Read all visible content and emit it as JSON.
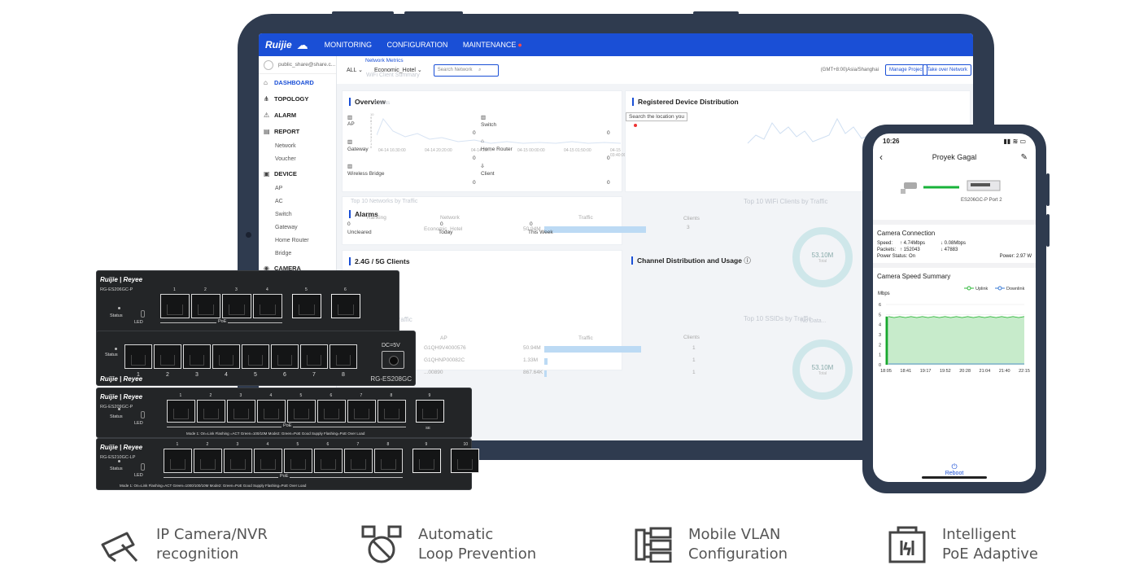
{
  "tablet": {
    "topbar": {
      "brand": "Ruijie",
      "nav": [
        "MONITORING",
        "CONFIGURATION",
        "MAINTENANCE"
      ]
    },
    "sidebar": {
      "user": "public_share@share.c...",
      "items": [
        {
          "label": "DASHBOARD",
          "icon": "home-icon",
          "active": true
        },
        {
          "label": "TOPOLOGY",
          "icon": "topology-icon"
        },
        {
          "label": "ALARM",
          "icon": "bell-icon"
        },
        {
          "label": "REPORT",
          "icon": "report-icon",
          "subs": [
            "Network",
            "Voucher"
          ]
        },
        {
          "label": "DEVICE",
          "icon": "device-icon",
          "subs": [
            "AP",
            "AC",
            "Switch",
            "Gateway",
            "Home Router",
            "Bridge"
          ]
        },
        {
          "label": "CAMERA",
          "icon": "camera-icon"
        }
      ]
    },
    "filterbar": {
      "crumb": "Network Metrics",
      "scope": "ALL",
      "project": "Economic_Hotel",
      "ghost": "WiFi Client Summary",
      "search_placeholder": "Search Network",
      "timezone": "(GMT+8:00)Asia/Shanghai",
      "manage_btn": "Manage Project",
      "takeover_btn": "Take over Network"
    },
    "overview": {
      "title": "Overview",
      "ghost": "Clients",
      "cells": [
        {
          "label": "AP",
          "value": "0"
        },
        {
          "label": "Switch",
          "value": "0"
        },
        {
          "label": "Gateway",
          "value": "0"
        },
        {
          "label": "Home Router",
          "value": "0"
        },
        {
          "label": "Wireless Bridge",
          "value": "0"
        },
        {
          "label": "Client",
          "value": "0"
        }
      ],
      "axis_ticks": [
        "10",
        "9",
        "8",
        "7",
        "6",
        "5",
        "4",
        "3",
        "2",
        "1",
        "0"
      ],
      "time_ticks": [
        "04-14 16:30:00",
        "04-14 20:20:00",
        "04-14 23:...",
        "04-15 00:00:00",
        "04-15 01:50:00",
        "04-15 03:40:00",
        "04-15 05:30:00",
        "04-15 07:20:00",
        "04-15 09:10:00",
        "04-15 11:00:00",
        "04-15 12:50:00"
      ]
    },
    "registered": {
      "title": "Registered Device Distribution",
      "search_placeholder": "Search the location you"
    },
    "top_networks": {
      "title": "Top 10 Networks by Traffic",
      "cols": [
        "Ranking",
        "Network",
        "Traffic",
        "Clients"
      ],
      "row": {
        "network": "Economic_Hotel",
        "traffic": "50.94M",
        "clients": "3"
      }
    },
    "alarms": {
      "title": "Alarms",
      "cells": [
        {
          "value": "0",
          "label": "Uncleared"
        },
        {
          "value": "0",
          "label": "Today"
        },
        {
          "value": "0",
          "label": "This Week"
        }
      ]
    },
    "top_wifi": {
      "title": "Top 10 WiFi Clients by Traffic",
      "donut_value": "53.10M",
      "donut_label": "Total"
    },
    "clients_24": {
      "title": "2.4G / 5G Clients"
    },
    "channel": {
      "title": "Channel Distribution and Usage",
      "ghost_no_data": "No Data..."
    },
    "top_ap": {
      "ghost_title": "Traffic",
      "cols": [
        "AP",
        "Traffic",
        "Clients"
      ],
      "rows": [
        {
          "ap": "G1QH9V4000576",
          "traffic": "50.94M",
          "clients": "1",
          "fill": 0.95
        },
        {
          "ap": "G1QHNP00082C",
          "traffic": "1.33M",
          "clients": "1",
          "fill": 0.03
        },
        {
          "ap": "...00890",
          "traffic": "867.64K",
          "clients": "1",
          "fill": 0.02
        }
      ]
    },
    "top_ssid": {
      "title": "Top 10 SSIDs by Traffic",
      "donut_value": "53.10M",
      "donut_label": "Total"
    }
  },
  "phone": {
    "time": "10:26",
    "title": "Proyek Gagal",
    "device": "ES206GC-P Port 2",
    "connection": {
      "title": "Camera Connection",
      "speed": {
        "label": "Speed:",
        "up": "4.74Mbps",
        "down": "0.08Mbps"
      },
      "packets": {
        "label": "Packets:",
        "up": "152043",
        "down": "47883"
      },
      "power_status": {
        "label": "Power Status:",
        "value": "On"
      },
      "power": {
        "label": "Power:",
        "value": "2.97 W"
      }
    },
    "chart_title": "Camera Speed Summary",
    "footer": "Reboot"
  },
  "chart_data": {
    "type": "line",
    "title": "Camera Speed Summary",
    "ylabel": "Mbps",
    "ylim": [
      0,
      6
    ],
    "yticks": [
      "6",
      "5",
      "4",
      "3",
      "2",
      "1",
      "0"
    ],
    "x": [
      "18:05",
      "18:41",
      "19:17",
      "19:52",
      "20:28",
      "21:04",
      "21:40",
      "22:15"
    ],
    "series": [
      {
        "name": "Uplink",
        "color": "#2fb83a",
        "values": [
          4.8,
          4.7,
          4.8,
          4.7,
          4.8,
          4.7,
          4.8,
          4.7,
          4.8,
          4.7,
          4.8,
          4.7,
          4.8,
          4.7,
          4.8,
          4.7,
          4.8,
          4.7,
          4.8,
          4.7,
          4.8,
          4.7,
          4.8,
          4.7,
          4.8
        ]
      },
      {
        "name": "Downlink",
        "color": "#3a7bd5",
        "values": [
          0.08,
          0.08,
          0.08,
          0.08,
          0.08,
          0.08,
          0.08,
          0.08,
          0.08,
          0.08,
          0.08,
          0.08,
          0.08,
          0.08,
          0.08,
          0.08,
          0.08,
          0.08,
          0.08,
          0.08,
          0.08,
          0.08,
          0.08,
          0.08,
          0.08
        ]
      }
    ]
  },
  "switches": [
    {
      "brand": "Ruijie | Reyee",
      "model": "RG-ES206GC-P",
      "status": "Status",
      "led": "LED",
      "poe": "PoE",
      "ports": [
        "1",
        "2",
        "3",
        "4",
        "5",
        "6"
      ],
      "mode_text": "Mode 1: On=Link Flashing=ACT Green=1000/100/10M    Mode2: Green=PoE Good Supply Flashing=PoE Over Load"
    },
    {
      "brand": "Ruijie | Reyee",
      "model": "RG-ES208GC",
      "status": "Status",
      "dc": "DC=5V",
      "ports": [
        "1",
        "2",
        "3",
        "4",
        "5",
        "6",
        "7",
        "8"
      ]
    },
    {
      "brand": "Ruijie | Reyee",
      "model": "RG-ES209GC-P",
      "status": "Status",
      "led": "LED",
      "poe": "PoE",
      "sfp": "SE",
      "ports": [
        "1",
        "2",
        "3",
        "4",
        "5",
        "6",
        "7",
        "8",
        "9"
      ],
      "mode_text": "Mode 1: On=Link Flashing =ACT Green=100/10M    Mode2: Green=PoE Good Supply Flashing=PoE Over Load"
    },
    {
      "brand": "Ruijie | Reyee",
      "model": "RG-ES210GC-LP",
      "status": "Status",
      "led": "LED",
      "poe": "PoE",
      "ports": [
        "1",
        "2",
        "3",
        "4",
        "5",
        "6",
        "7",
        "8",
        "9",
        "10"
      ],
      "mode_text": "Mode 1: On=Link Flashing=ACT Green=1000/100/10M    Mode2: Green=PoE Good Supply Flashing=PoE Over Load"
    }
  ],
  "features": [
    {
      "icon": "camera-icon",
      "line1": "IP Camera/NVR",
      "line2": "recognition"
    },
    {
      "icon": "loop-prevention-icon",
      "line1": "Automatic",
      "line2": "Loop Prevention"
    },
    {
      "icon": "vlan-icon",
      "line1": "Mobile VLAN",
      "line2": "Configuration"
    },
    {
      "icon": "poe-icon",
      "line1": "Intelligent",
      "line2": "PoE Adaptive"
    }
  ]
}
